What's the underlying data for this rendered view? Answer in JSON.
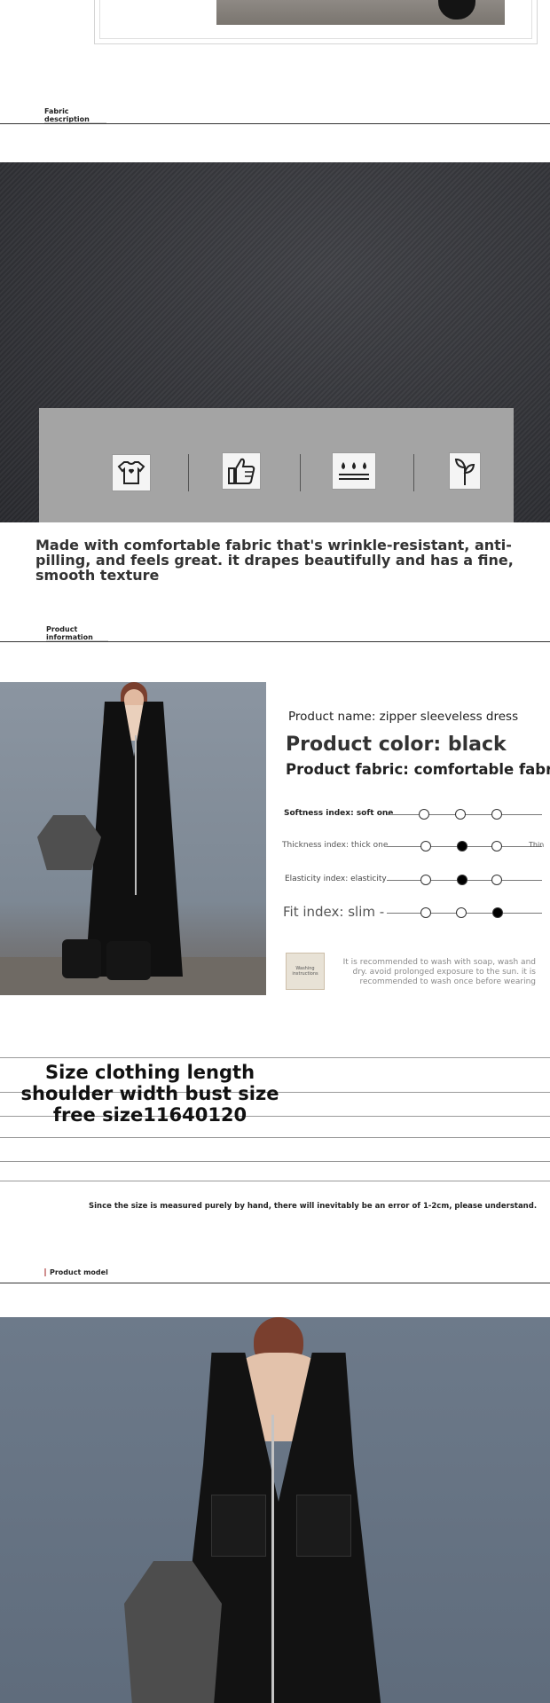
{
  "sections": {
    "fabric_label": "Fabric description",
    "product_label": "Product information",
    "model_label": "Product model"
  },
  "fabric": {
    "description": "Made with comfortable fabric that's wrinkle-resistant, anti-pilling, and feels great. it drapes beautifully and has a fine, smooth texture",
    "icons": [
      "tshirt-heart-icon",
      "thumbs-up-icon",
      "water-drops-icon",
      "sprout-icon"
    ]
  },
  "product": {
    "name": "Product name: zipper sleeveless dress",
    "color": "Product color: black",
    "fabric": "Product fabric: comfortable fabric",
    "indices": [
      {
        "label": "Softness index: soft one",
        "selected": 0
      },
      {
        "label": "Thickness index: thick one",
        "selected": 2
      },
      {
        "label": "Elasticity index: elasticity",
        "selected": 2
      },
      {
        "label": "Fit index: slim -",
        "selected": 3
      }
    ],
    "thickness_end": "Thin",
    "wash_label": "Washing instructions",
    "wash_text": "It is recommended to wash with soap, wash and dry. avoid prolonged exposure to the sun. it is recommended to wash once before wearing"
  },
  "size": {
    "title": "Size clothing length shoulder width bust size free size11640120",
    "note": "Since the size is measured purely by hand, there will inevitably be an error of 1-2cm, please understand."
  }
}
